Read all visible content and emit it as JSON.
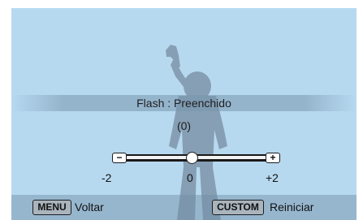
{
  "setting": {
    "label": "Flash : Preenchido",
    "value": "(0)"
  },
  "exposure_slider": {
    "min_label": "-2",
    "mid_label": "0",
    "max_label": "+2",
    "minus_icon": "minus-icon",
    "plus_icon": "plus-icon",
    "current_value": 0
  },
  "footer": {
    "menu_key": "MENU",
    "menu_action": "Voltar",
    "custom_key": "CUSTOM",
    "custom_action": "Reiniciar"
  },
  "colors": {
    "screen_background": "#b7d9f0",
    "silhouette": "#7e96aa",
    "track": "#1a1a1a"
  }
}
